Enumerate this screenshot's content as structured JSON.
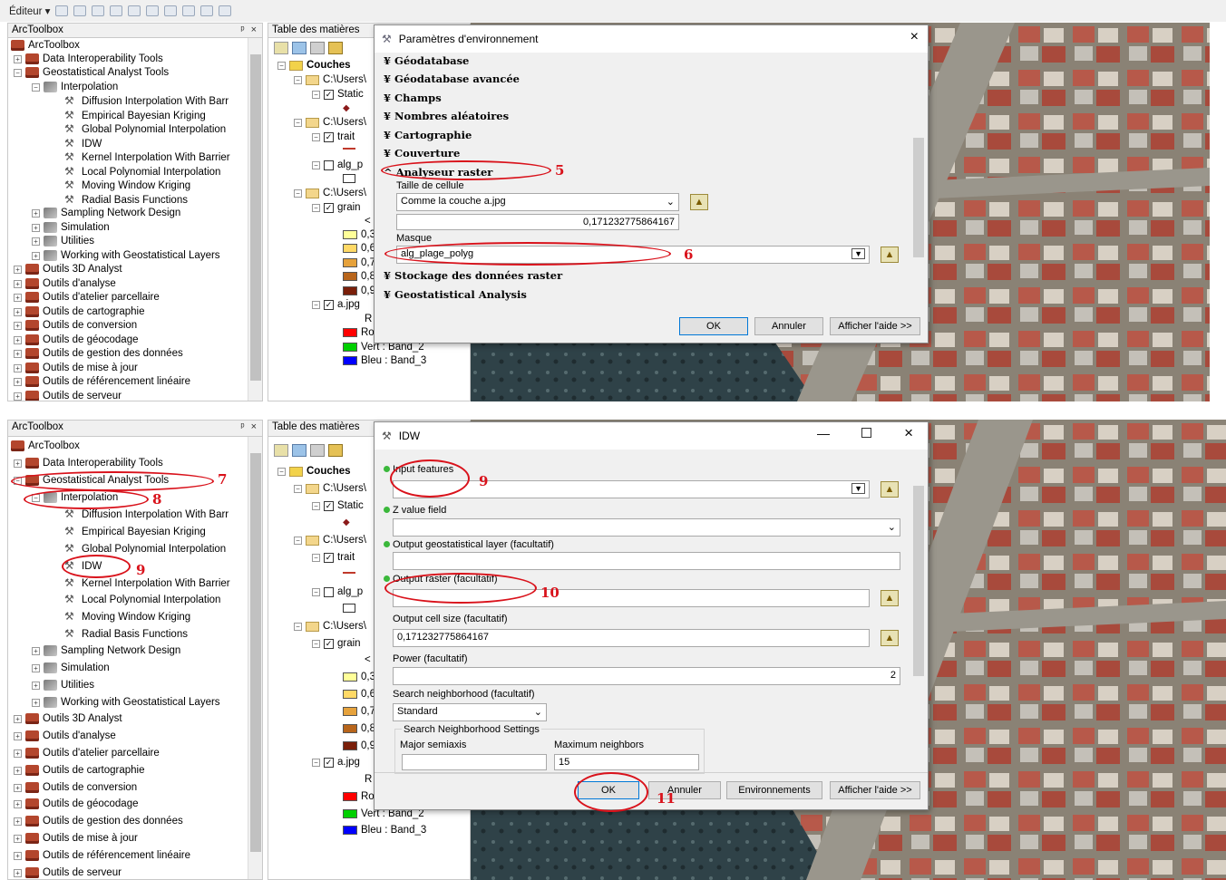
{
  "toolbar": {
    "editor_label": "Éditeur ▾"
  },
  "panels": {
    "arctoolbox_title": "ArcToolbox",
    "toc_title": "Table des matières",
    "close_ctrl": "ᵖ ×"
  },
  "toolbox": {
    "root": "ArcToolbox",
    "data_interop": "Data Interoperability Tools",
    "geostat": "Geostatistical Analyst Tools",
    "interpolation": "Interpolation",
    "tools": [
      "Diffusion Interpolation With Barr",
      "Empirical Bayesian Kriging",
      "Global Polynomial Interpolation",
      "IDW",
      "Kernel Interpolation With Barrier",
      "Local Polynomial Interpolation",
      "Moving Window Kriging",
      "Radial Basis Functions"
    ],
    "subsets": [
      "Sampling Network Design",
      "Simulation",
      "Utilities",
      "Working with Geostatistical Layers"
    ],
    "outils": [
      "Outils 3D Analyst",
      "Outils d'analyse",
      "Outils d'atelier parcellaire",
      "Outils de cartographie",
      "Outils de conversion",
      "Outils de géocodage",
      "Outils de gestion des données",
      "Outils de mise à jour",
      "Outils de référencement linéaire",
      "Outils de serveur"
    ]
  },
  "toc": {
    "couches": "Couches",
    "users1": "C:\\Users\\",
    "static": "Static",
    "users2": "C:\\Users\\",
    "trait": "trait",
    "alg": "alg_p",
    "users3": "C:\\Users\\",
    "grain": "grain",
    "lt": "<",
    "classes": [
      "0,3",
      "0,6",
      "0,7",
      "0,8",
      "0,9"
    ],
    "class_colors": [
      "#ffff99",
      "#ffd966",
      "#e6a23c",
      "#b8651b",
      "#7a1f0a"
    ],
    "ajpg": "a.jpg",
    "rgb_short": "R",
    "ro": "Ro",
    "vert": "Vert :  Band_2",
    "bleu": "Bleu :  Band_3",
    "band_colors": [
      "#ff0000",
      "#00d000",
      "#0000ff"
    ]
  },
  "env_dialog": {
    "title": "Paramètres d'environnement",
    "sections_top": [
      "Géodatabase",
      "Géodatabase avancée",
      "Champs",
      "Nombres aléatoires",
      "Cartographie",
      "Couverture"
    ],
    "raster_section": "Analyseur raster",
    "cell_size_label": "Taille de cellule",
    "cell_size_option": "Comme la couche a.jpg",
    "cell_size_value": "0,171232775864167",
    "mask_label": "Masque",
    "mask_value": "alg_plage_polyg",
    "sections_bottom": [
      "Stockage des données raster",
      "Geostatistical Analysis"
    ],
    "ok": "OK",
    "cancel": "Annuler",
    "help": "Afficher l'aide >>"
  },
  "idw_dialog": {
    "title": "IDW",
    "input_features": "Input features",
    "z_value": "Z value field",
    "output_geo": "Output geostatistical layer (facultatif)",
    "output_raster": "Output raster (facultatif)",
    "cell_size_label": "Output cell size (facultatif)",
    "cell_size_value": "0,171232775864167",
    "power_label": "Power (facultatif)",
    "power_value": "2",
    "search_label": "Search neighborhood (facultatif)",
    "search_value": "Standard",
    "settings_title": "Search Neighborhood Settings",
    "major": "Major semiaxis",
    "max_neighbors": "Maximum neighbors",
    "max_neighbors_value": "15",
    "ok": "OK",
    "cancel": "Annuler",
    "env": "Environnements",
    "help": "Afficher l'aide >>"
  },
  "annotations": {
    "n5": "5",
    "n6": "6",
    "n7": "7",
    "n8": "8",
    "n9a": "9",
    "n9b": "9",
    "n10": "10",
    "n11": "11"
  }
}
